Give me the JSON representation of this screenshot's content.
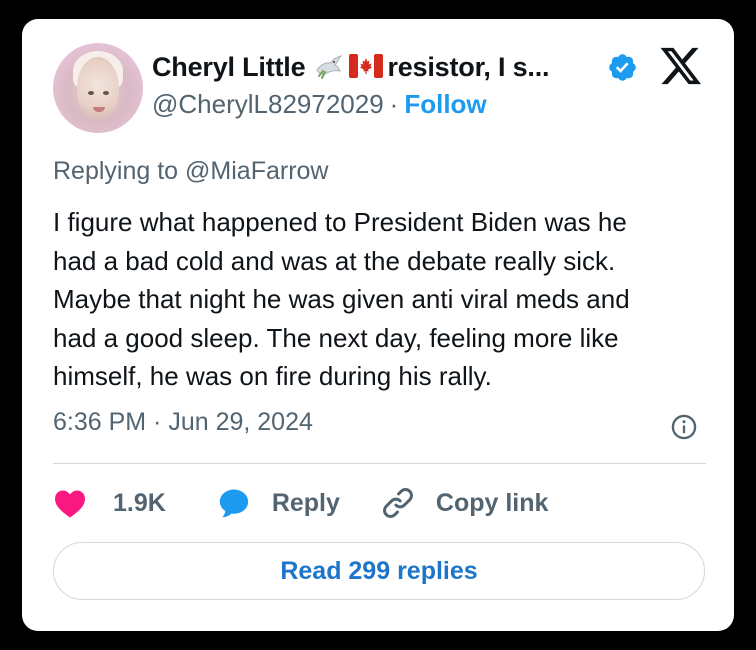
{
  "author": {
    "display_name_part1": "Cheryl Little",
    "display_name_part2": "resistor, I s...",
    "handle": "@CherylL82972029",
    "separator": "·",
    "follow_label": "Follow",
    "emoji_icons": [
      "dove-icon",
      "canada-flag-icon"
    ],
    "verified": true
  },
  "tweet": {
    "replying_prefix": "Replying to",
    "replying_to": "@MiaFarrow",
    "lines": [
      "I figure what happened to President Biden was he",
      "had a bad cold and was at the debate really sick.",
      "Maybe that night he was given anti viral meds and",
      "had a good sleep. The next day, feeling more like",
      "himself, he was on fire during his rally."
    ],
    "timestamp": "6:36 PM · Jun 29, 2024"
  },
  "actions": {
    "like_count": "1.9K",
    "reply_label": "Reply",
    "copy_link_label": "Copy link"
  },
  "read_replies_label": "Read 299 replies",
  "colors": {
    "accent_blue": "#1d9bf0",
    "like_pink": "#f91880",
    "text_primary": "#0f1419",
    "text_secondary": "#536471",
    "border": "#cfd9de"
  }
}
